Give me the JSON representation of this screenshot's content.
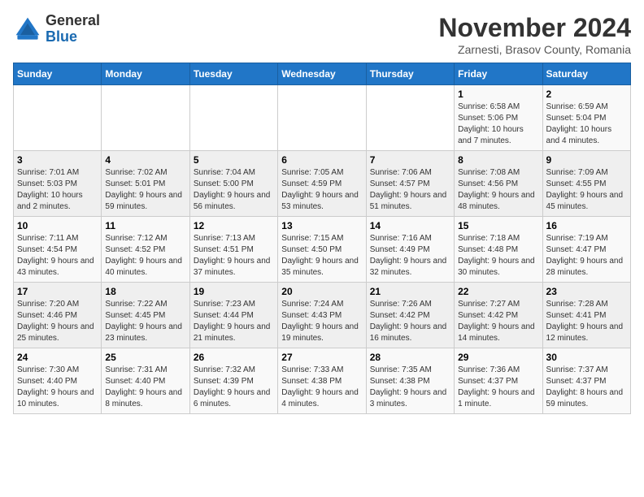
{
  "header": {
    "logo_general": "General",
    "logo_blue": "Blue",
    "month_title": "November 2024",
    "location": "Zarnesti, Brasov County, Romania"
  },
  "weekdays": [
    "Sunday",
    "Monday",
    "Tuesday",
    "Wednesday",
    "Thursday",
    "Friday",
    "Saturday"
  ],
  "weeks": [
    [
      {
        "day": "",
        "info": ""
      },
      {
        "day": "",
        "info": ""
      },
      {
        "day": "",
        "info": ""
      },
      {
        "day": "",
        "info": ""
      },
      {
        "day": "",
        "info": ""
      },
      {
        "day": "1",
        "info": "Sunrise: 6:58 AM\nSunset: 5:06 PM\nDaylight: 10 hours and 7 minutes."
      },
      {
        "day": "2",
        "info": "Sunrise: 6:59 AM\nSunset: 5:04 PM\nDaylight: 10 hours and 4 minutes."
      }
    ],
    [
      {
        "day": "3",
        "info": "Sunrise: 7:01 AM\nSunset: 5:03 PM\nDaylight: 10 hours and 2 minutes."
      },
      {
        "day": "4",
        "info": "Sunrise: 7:02 AM\nSunset: 5:01 PM\nDaylight: 9 hours and 59 minutes."
      },
      {
        "day": "5",
        "info": "Sunrise: 7:04 AM\nSunset: 5:00 PM\nDaylight: 9 hours and 56 minutes."
      },
      {
        "day": "6",
        "info": "Sunrise: 7:05 AM\nSunset: 4:59 PM\nDaylight: 9 hours and 53 minutes."
      },
      {
        "day": "7",
        "info": "Sunrise: 7:06 AM\nSunset: 4:57 PM\nDaylight: 9 hours and 51 minutes."
      },
      {
        "day": "8",
        "info": "Sunrise: 7:08 AM\nSunset: 4:56 PM\nDaylight: 9 hours and 48 minutes."
      },
      {
        "day": "9",
        "info": "Sunrise: 7:09 AM\nSunset: 4:55 PM\nDaylight: 9 hours and 45 minutes."
      }
    ],
    [
      {
        "day": "10",
        "info": "Sunrise: 7:11 AM\nSunset: 4:54 PM\nDaylight: 9 hours and 43 minutes."
      },
      {
        "day": "11",
        "info": "Sunrise: 7:12 AM\nSunset: 4:52 PM\nDaylight: 9 hours and 40 minutes."
      },
      {
        "day": "12",
        "info": "Sunrise: 7:13 AM\nSunset: 4:51 PM\nDaylight: 9 hours and 37 minutes."
      },
      {
        "day": "13",
        "info": "Sunrise: 7:15 AM\nSunset: 4:50 PM\nDaylight: 9 hours and 35 minutes."
      },
      {
        "day": "14",
        "info": "Sunrise: 7:16 AM\nSunset: 4:49 PM\nDaylight: 9 hours and 32 minutes."
      },
      {
        "day": "15",
        "info": "Sunrise: 7:18 AM\nSunset: 4:48 PM\nDaylight: 9 hours and 30 minutes."
      },
      {
        "day": "16",
        "info": "Sunrise: 7:19 AM\nSunset: 4:47 PM\nDaylight: 9 hours and 28 minutes."
      }
    ],
    [
      {
        "day": "17",
        "info": "Sunrise: 7:20 AM\nSunset: 4:46 PM\nDaylight: 9 hours and 25 minutes."
      },
      {
        "day": "18",
        "info": "Sunrise: 7:22 AM\nSunset: 4:45 PM\nDaylight: 9 hours and 23 minutes."
      },
      {
        "day": "19",
        "info": "Sunrise: 7:23 AM\nSunset: 4:44 PM\nDaylight: 9 hours and 21 minutes."
      },
      {
        "day": "20",
        "info": "Sunrise: 7:24 AM\nSunset: 4:43 PM\nDaylight: 9 hours and 19 minutes."
      },
      {
        "day": "21",
        "info": "Sunrise: 7:26 AM\nSunset: 4:42 PM\nDaylight: 9 hours and 16 minutes."
      },
      {
        "day": "22",
        "info": "Sunrise: 7:27 AM\nSunset: 4:42 PM\nDaylight: 9 hours and 14 minutes."
      },
      {
        "day": "23",
        "info": "Sunrise: 7:28 AM\nSunset: 4:41 PM\nDaylight: 9 hours and 12 minutes."
      }
    ],
    [
      {
        "day": "24",
        "info": "Sunrise: 7:30 AM\nSunset: 4:40 PM\nDaylight: 9 hours and 10 minutes."
      },
      {
        "day": "25",
        "info": "Sunrise: 7:31 AM\nSunset: 4:40 PM\nDaylight: 9 hours and 8 minutes."
      },
      {
        "day": "26",
        "info": "Sunrise: 7:32 AM\nSunset: 4:39 PM\nDaylight: 9 hours and 6 minutes."
      },
      {
        "day": "27",
        "info": "Sunrise: 7:33 AM\nSunset: 4:38 PM\nDaylight: 9 hours and 4 minutes."
      },
      {
        "day": "28",
        "info": "Sunrise: 7:35 AM\nSunset: 4:38 PM\nDaylight: 9 hours and 3 minutes."
      },
      {
        "day": "29",
        "info": "Sunrise: 7:36 AM\nSunset: 4:37 PM\nDaylight: 9 hours and 1 minute."
      },
      {
        "day": "30",
        "info": "Sunrise: 7:37 AM\nSunset: 4:37 PM\nDaylight: 8 hours and 59 minutes."
      }
    ]
  ]
}
